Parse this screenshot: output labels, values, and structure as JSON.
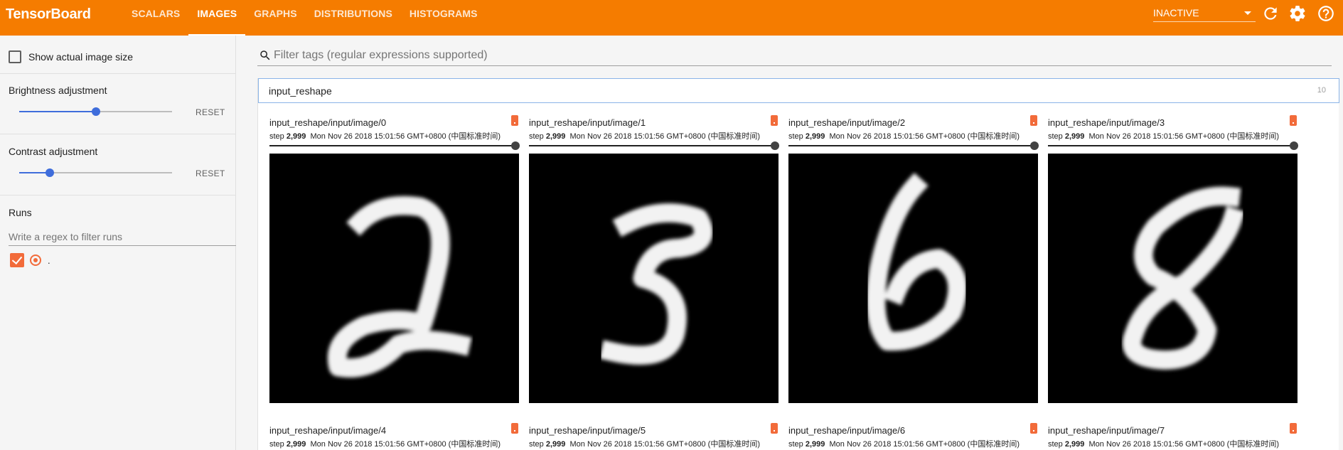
{
  "header": {
    "brand": "TensorBoard",
    "tabs": [
      {
        "label": "SCALARS"
      },
      {
        "label": "IMAGES"
      },
      {
        "label": "GRAPHS"
      },
      {
        "label": "DISTRIBUTIONS"
      },
      {
        "label": "HISTOGRAMS"
      }
    ],
    "active_tab": "IMAGES",
    "status_select": "INACTIVE",
    "icons": [
      "refresh-icon",
      "settings-icon",
      "help-icon"
    ],
    "bar_color": "#f57c00"
  },
  "sidebar": {
    "show_actual_size_label": "Show actual image size",
    "show_actual_size_checked": false,
    "brightness": {
      "label": "Brightness adjustment",
      "reset_label": "RESET",
      "level": 0.5
    },
    "contrast": {
      "label": "Contrast adjustment",
      "reset_label": "RESET",
      "level": 0.2
    },
    "runs": {
      "title": "Runs",
      "filter_placeholder": "Write a regex to filter runs",
      "items": [
        {
          "name": ".",
          "checked": true,
          "color": "#f26b3a"
        }
      ]
    }
  },
  "main": {
    "filter_placeholder": "Filter tags (regular expressions supported)",
    "group": {
      "name": "input_reshape",
      "count": "10"
    },
    "cards": [
      {
        "tag": "input_reshape/input/image/0",
        "step_label": "step",
        "step": "2,999",
        "time": "Mon Nov 26 2018 15:01:56 GMT+0800 (中国标准时间)",
        "digit": "2"
      },
      {
        "tag": "input_reshape/input/image/1",
        "step_label": "step",
        "step": "2,999",
        "time": "Mon Nov 26 2018 15:01:56 GMT+0800 (中国标准时间)",
        "digit": "3"
      },
      {
        "tag": "input_reshape/input/image/2",
        "step_label": "step",
        "step": "2,999",
        "time": "Mon Nov 26 2018 15:01:56 GMT+0800 (中国标准时间)",
        "digit": "6"
      },
      {
        "tag": "input_reshape/input/image/3",
        "step_label": "step",
        "step": "2,999",
        "time": "Mon Nov 26 2018 15:01:56 GMT+0800 (中国标准时间)",
        "digit": "8"
      },
      {
        "tag": "input_reshape/input/image/4",
        "step_label": "step",
        "step": "2,999",
        "time": "Mon Nov 26 2018 15:01:56 GMT+0800 (中国标准时间)"
      },
      {
        "tag": "input_reshape/input/image/5",
        "step_label": "step",
        "step": "2,999",
        "time": "Mon Nov 26 2018 15:01:56 GMT+0800 (中国标准时间)"
      },
      {
        "tag": "input_reshape/input/image/6",
        "step_label": "step",
        "step": "2,999",
        "time": "Mon Nov 26 2018 15:01:56 GMT+0800 (中国标准时间)"
      },
      {
        "tag": "input_reshape/input/image/7",
        "step_label": "step",
        "step": "2,999",
        "time": "Mon Nov 26 2018 15:01:56 GMT+0800 (中国标准时间)"
      }
    ]
  }
}
